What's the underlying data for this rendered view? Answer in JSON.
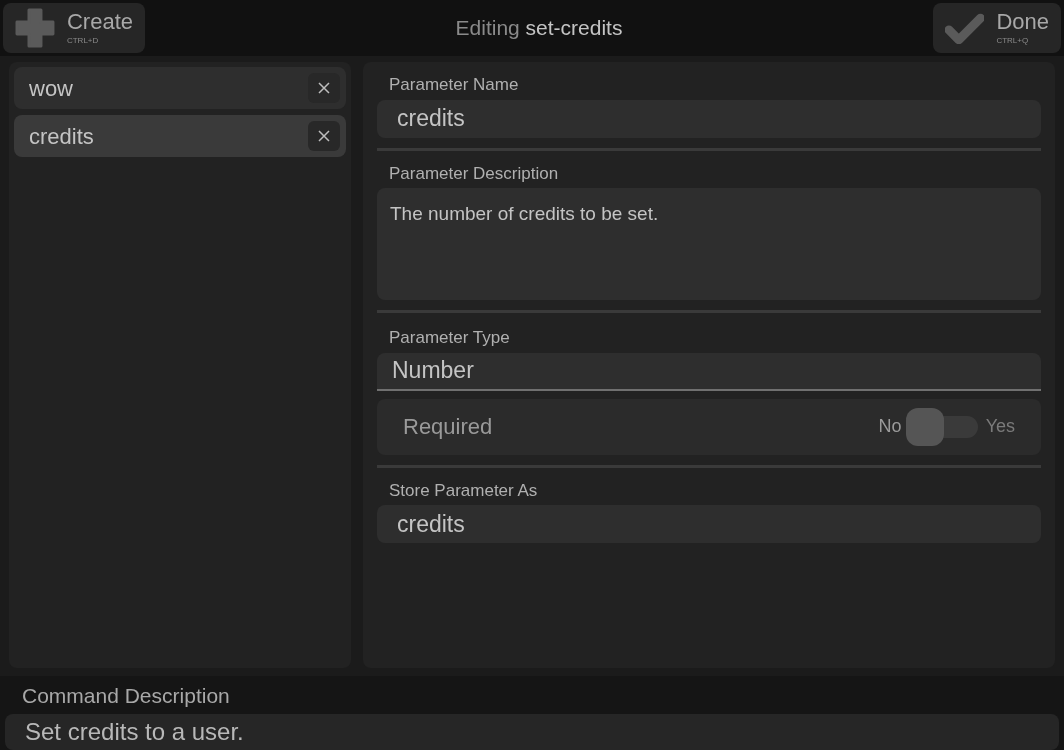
{
  "header": {
    "create": {
      "label": "Create",
      "shortcut": "CTRL+D"
    },
    "title_prefix": "Editing",
    "title_name": "set-credits",
    "done": {
      "label": "Done",
      "shortcut": "CTRL+Q"
    }
  },
  "parameters": [
    {
      "name": "wow",
      "selected": false
    },
    {
      "name": "credits",
      "selected": true
    }
  ],
  "editor": {
    "name_label": "Parameter Name",
    "name_value": "credits",
    "description_label": "Parameter Description",
    "description_value": "The number of credits to be set.",
    "type_label": "Parameter Type",
    "type_value": "Number",
    "required_label": "Required",
    "required_no": "No",
    "required_yes": "Yes",
    "required": false,
    "store_label": "Store Parameter As",
    "store_value": "credits"
  },
  "command_description": {
    "label": "Command Description",
    "value": "Set credits to a user."
  }
}
